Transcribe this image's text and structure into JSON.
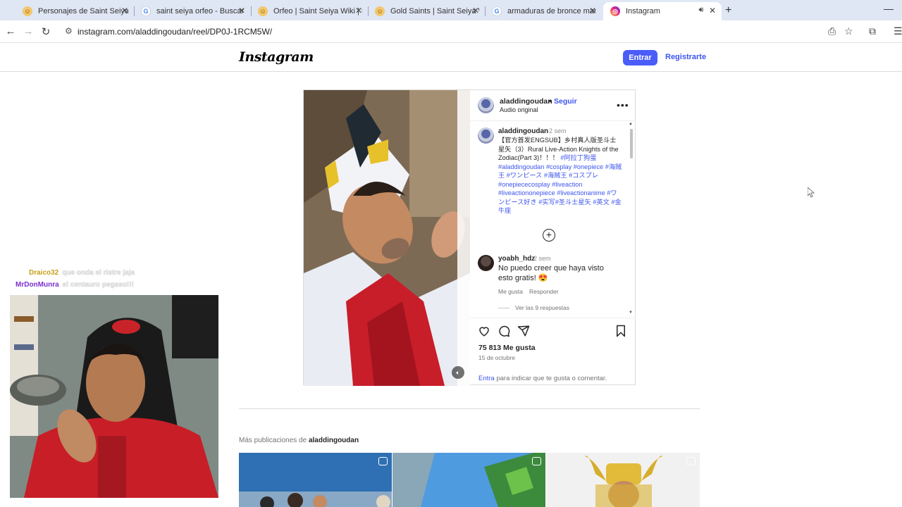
{
  "browser": {
    "tabs": [
      {
        "title": "Personajes de Saint Seiya: La ar",
        "favicon": "face-favicon",
        "active": false
      },
      {
        "title": "saint seiya orfeo - Buscar con G",
        "favicon": "google-favicon",
        "active": false
      },
      {
        "title": "Orfeo | Saint Seiya Wiki | Fando",
        "favicon": "face-favicon",
        "active": false
      },
      {
        "title": "Gold Saints | Saint Seiya Wiki | F",
        "favicon": "face-favicon",
        "active": false
      },
      {
        "title": "armaduras de bronce manga - G",
        "favicon": "google-favicon",
        "active": false
      },
      {
        "title": "Instagram",
        "favicon": "instagram-favicon",
        "active": true
      }
    ],
    "url": "instagram.com/aladdingoudan/reel/DP0J-1RCM5W/",
    "colors": {
      "tabstrip": "#dfe6f4",
      "accent": "#4a5df9"
    }
  },
  "header": {
    "logo": "Instagram",
    "login_label": "Entrar",
    "signup_label": "Registrarte"
  },
  "post": {
    "author": {
      "username": "aladdingoudan",
      "separator": "•",
      "follow_label": "Seguir",
      "audio": "Audio original"
    },
    "caption": {
      "username": "aladdingoudan",
      "time": "2 sem",
      "text": "【官方首发ENGSUB】乡村真人版圣斗士星矢（3）Rural Live-Action Knights of the Zodiac(Part 3)！！！",
      "tags": "#阿拉丁狗蛋 #aladdingoudan #cosplay #onepiece #海賊王 #ワンピース #海贼王 #コスプレ #onepiececosplay #liveaction #liveactiononepiece #liveactionanime #ワンピース好き #实写#圣斗士星矢 #英文 #金牛座"
    },
    "comment": {
      "username": "yoabh_hdz",
      "time": "2 sem",
      "text": "No puedo creer que haya visto esto gratis! 😍",
      "like_label": "Me gusta",
      "reply_label": "Responder",
      "view_replies": "Ver las 9 respuestas"
    },
    "likes": "75 813 Me gusta",
    "date": "15 de octubre",
    "login_prompt": {
      "link": "Entra",
      "rest": " para indicar que te gusta o comentar."
    }
  },
  "more_posts": {
    "prefix": "Más publicaciones de ",
    "username": "aladdingoudan"
  },
  "stream_chat": [
    {
      "name": "Draico32",
      "message": "que onda el ristre jaja"
    },
    {
      "name": "MrDonMunra",
      "message": "el centauro pegaso!!!"
    }
  ]
}
